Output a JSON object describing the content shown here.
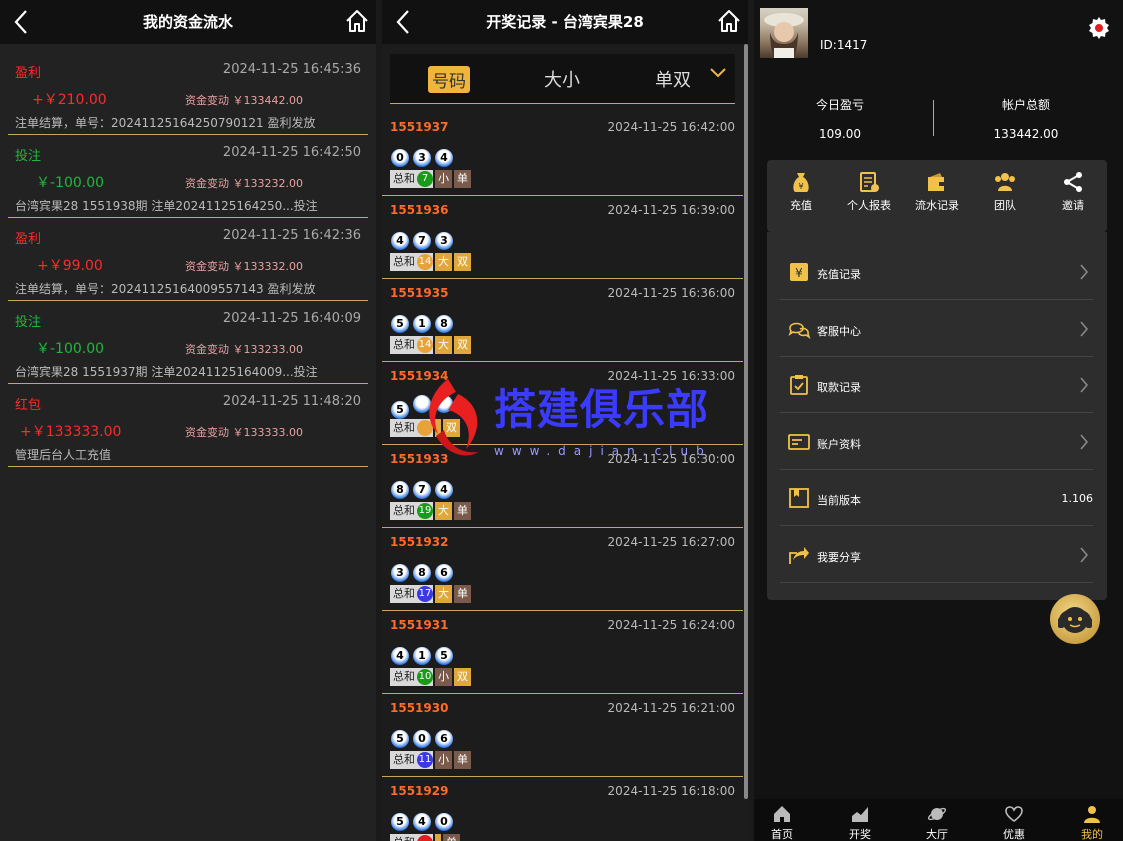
{
  "panel1": {
    "title": "我的资金流水",
    "change_label": "资金变动",
    "records": [
      {
        "type": "盈利",
        "type_color": "red",
        "time": "2024-11-25 16:45:36",
        "amount": "+￥210.00",
        "amount_color": "red",
        "balance": "￥133442.00",
        "desc": "注单结算，单号：20241125164250790121 盈利发放"
      },
      {
        "type": "投注",
        "type_color": "green",
        "time": "2024-11-25 16:42:50",
        "amount": "￥-100.00",
        "amount_color": "green",
        "balance": "￥133232.00",
        "desc": "台湾宾果28 1551938期 注单20241125164250...投注"
      },
      {
        "type": "盈利",
        "type_color": "red",
        "time": "2024-11-25 16:42:36",
        "amount": "+￥99.00",
        "amount_color": "red",
        "balance": "￥133332.00",
        "desc": "注单结算，单号：20241125164009557143 盈利发放"
      },
      {
        "type": "投注",
        "type_color": "green",
        "time": "2024-11-25 16:40:09",
        "amount": "￥-100.00",
        "amount_color": "green",
        "balance": "￥133233.00",
        "desc": "台湾宾果28 1551937期 注单20241125164009...投注"
      },
      {
        "type": "红包",
        "type_color": "red",
        "time": "2024-11-25 11:48:20",
        "amount": "+￥133333.00",
        "amount_color": "red",
        "balance": "￥133333.00",
        "desc": "管理后台人工充值"
      }
    ]
  },
  "panel2": {
    "title": "开奖记录 - 台湾宾果28",
    "tabs": [
      "号码",
      "大小",
      "单双"
    ],
    "sum_label": "总和",
    "draws": [
      {
        "issue": "1551937",
        "time": "2024-11-25 16:42:00",
        "balls": [
          "0",
          "3",
          "4"
        ],
        "sum": "7",
        "sum_color": "#1a9a1a",
        "size": "小",
        "parity": "单"
      },
      {
        "issue": "1551936",
        "time": "2024-11-25 16:39:00",
        "balls": [
          "4",
          "7",
          "3"
        ],
        "sum": "14",
        "sum_color": "#e8a23a",
        "size": "大",
        "parity": "双"
      },
      {
        "issue": "1551935",
        "time": "2024-11-25 16:36:00",
        "balls": [
          "5",
          "1",
          "8"
        ],
        "sum": "14",
        "sum_color": "#e8a23a",
        "size": "大",
        "parity": "双"
      },
      {
        "issue": "1551934",
        "time": "2024-11-25 16:33:00",
        "balls": [
          "5",
          "",
          ""
        ],
        "sum": "",
        "sum_color": "#e8a23a",
        "size": "",
        "parity": "双"
      },
      {
        "issue": "1551933",
        "time": "2024-11-25 16:30:00",
        "balls": [
          "8",
          "7",
          "4"
        ],
        "sum": "19",
        "sum_color": "#1a9a1a",
        "size": "大",
        "parity": "单"
      },
      {
        "issue": "1551932",
        "time": "2024-11-25 16:27:00",
        "balls": [
          "3",
          "8",
          "6"
        ],
        "sum": "17",
        "sum_color": "#3a3ae0",
        "size": "大",
        "parity": "单"
      },
      {
        "issue": "1551931",
        "time": "2024-11-25 16:24:00",
        "balls": [
          "4",
          "1",
          "5"
        ],
        "sum": "10",
        "sum_color": "#1a9a1a",
        "size": "小",
        "parity": "双"
      },
      {
        "issue": "1551930",
        "time": "2024-11-25 16:21:00",
        "balls": [
          "5",
          "0",
          "6"
        ],
        "sum": "11",
        "sum_color": "#3a3ae0",
        "size": "小",
        "parity": "单"
      },
      {
        "issue": "1551929",
        "time": "2024-11-25 16:18:00",
        "balls": [
          "5",
          "4",
          "0"
        ],
        "sum": "",
        "sum_color": "#e02020",
        "size": "",
        "parity": "单"
      }
    ],
    "tag_colors": {
      "小": "#7a5a4a",
      "大": "#e0a83a",
      "单": "#7a5a4a",
      "双": "#e0a83a"
    }
  },
  "watermark": {
    "text": "搭建俱乐部",
    "sub": "www.dajian.club"
  },
  "panel3": {
    "user_id": "ID:1417",
    "stats": [
      {
        "label": "今日盈亏",
        "value": "109.00"
      },
      {
        "label": "帐户总额",
        "value": "133442.00"
      }
    ],
    "quick": [
      "充值",
      "个人报表",
      "流水记录",
      "团队",
      "邀请"
    ],
    "menu": [
      {
        "label": "充值记录",
        "icon": "yen-card-icon"
      },
      {
        "label": "客服中心",
        "icon": "chat-icon"
      },
      {
        "label": "取款记录",
        "icon": "clipboard-check-icon"
      },
      {
        "label": "账户资料",
        "icon": "id-card-icon"
      },
      {
        "label": "当前版本",
        "icon": "bookmark-icon",
        "value": "1.106"
      },
      {
        "label": "我要分享",
        "icon": "share-arrow-icon"
      }
    ],
    "nav": [
      "首页",
      "开奖",
      "大厅",
      "优惠",
      "我的"
    ],
    "accent": "#f0c24a"
  }
}
